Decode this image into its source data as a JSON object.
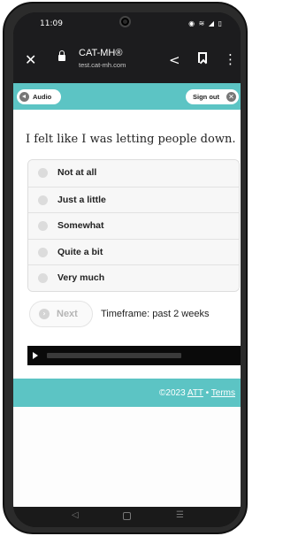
{
  "status_bar": {
    "time": "11:09",
    "icons": "◉ ≋ ◢ ▯"
  },
  "browser": {
    "close_symbol": "✕",
    "title": "CAT-MH®",
    "url": "test.cat-mh.com",
    "share_symbol": "<",
    "menu_symbol": "⋮"
  },
  "header": {
    "audio_label": "Audio",
    "signout_label": "Sign out",
    "signout_symbol": "✕"
  },
  "question": {
    "text": "I felt like I was letting people down."
  },
  "options": [
    "Not at all",
    "Just a little",
    "Somewhat",
    "Quite a bit",
    "Very much"
  ],
  "next": {
    "label": "Next",
    "symbol": "›"
  },
  "timeframe": "Timeframe: past 2 weeks",
  "audio_player": {
    "progress": 0
  },
  "footer": {
    "copyright": "©2023",
    "brand": "ATT",
    "separator": "•",
    "terms": "Terms"
  },
  "system_nav": {
    "back": "◁",
    "recents": "☰"
  },
  "colors": {
    "accent": "#5cc4c4",
    "player": "#0a0a0a"
  }
}
